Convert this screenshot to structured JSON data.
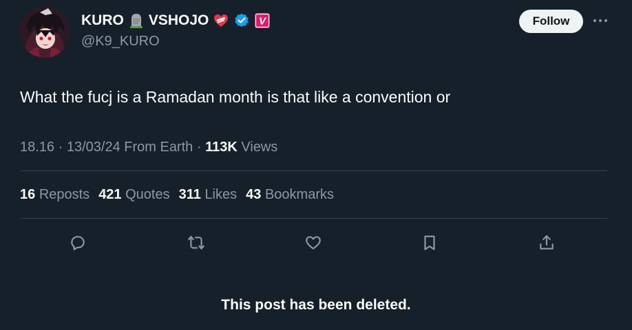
{
  "author": {
    "name_part1": "KURO",
    "name_part2": "VSHOJO",
    "handle": "@K9_KURO",
    "badge_letter": "V",
    "icons": [
      "headstone-icon",
      "mended-heart-icon",
      "verified-icon",
      "vshojo-badge-icon"
    ]
  },
  "header": {
    "follow_label": "Follow",
    "more_icon": "ellipsis-icon"
  },
  "tweet": {
    "text": "What the fucj is a Ramadan month is that like a convention or"
  },
  "meta": {
    "time": "18.16",
    "sep1": "·",
    "date": "13/03/24",
    "location": "From Earth",
    "sep2": "·",
    "views_count": "113K",
    "views_label": "Views"
  },
  "stats": [
    {
      "count": "16",
      "label": "Reposts"
    },
    {
      "count": "421",
      "label": "Quotes"
    },
    {
      "count": "311",
      "label": "Likes"
    },
    {
      "count": "43",
      "label": "Bookmarks"
    }
  ],
  "actions": [
    "reply-icon",
    "repost-icon",
    "like-icon",
    "bookmark-icon",
    "share-icon"
  ],
  "notice": "This post has been deleted.",
  "colors": {
    "background": "#15202b",
    "text": "#ffffff",
    "muted": "#8b98a5",
    "verified": "#1d9bf0",
    "vshojo": "#e0196f",
    "divider": "#38444d"
  }
}
